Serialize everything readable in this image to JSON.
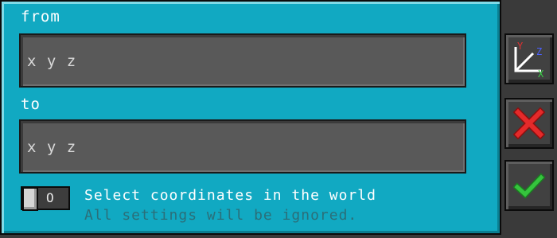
{
  "dialog": {
    "from_label": "from",
    "from_value": "x y z",
    "to_label": "to",
    "to_value": "x y z",
    "toggle_state": "O",
    "select_label": "Select coordinates in the world",
    "select_note": "All settings will be ignored."
  },
  "axes_icon": {
    "x": "X",
    "y": "Y",
    "z": "Z"
  },
  "colors": {
    "panel": "#11a9c2",
    "field": "#595959",
    "note_text": "#2b6f79",
    "cancel": "#e52a2a",
    "confirm": "#35c43d"
  }
}
